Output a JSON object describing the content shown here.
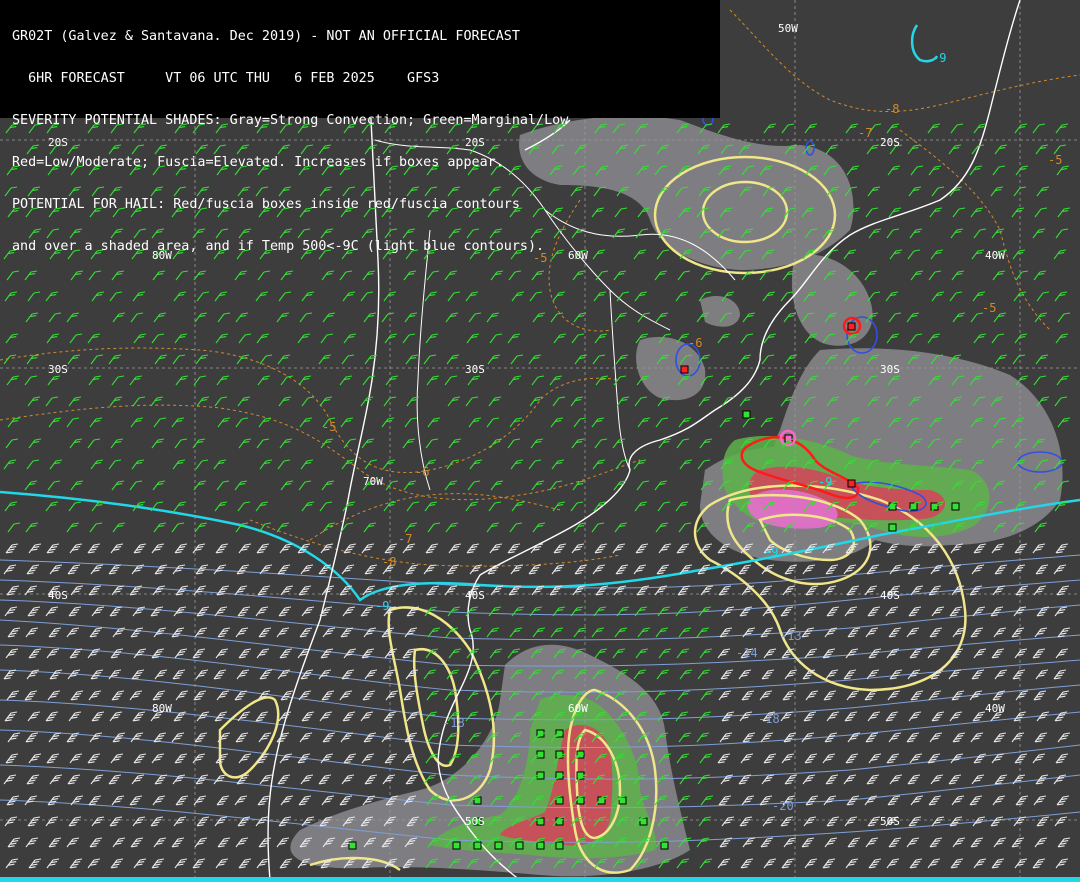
{
  "header": {
    "line1": "GR02T (Galvez & Santavana. Dec 2019) - NOT AN OFFICIAL FORECAST",
    "line2": "  6HR FORECAST     VT 06 UTC THU   6 FEB 2025    GFS3",
    "line3": "SEVERITY POTENTIAL SHADES: Gray=Strong Convection; Green=Marginal/Low",
    "line4": "Red=Low/Moderate; Fuscia=Elevated. Increases if boxes appear.",
    "line5": "POTENTIAL FOR HAIL: Red/fuscia boxes inside red/fuscia contours",
    "line6": "and over a shaded area, and if Temp 500<-9C (light blue contours)."
  },
  "grid_labels": {
    "lat20w": "20S",
    "lat20c": "20S",
    "lat20e": "20S",
    "lat30w": "30S",
    "lat30c": "30S",
    "lat30e": "30S",
    "lat40w": "40S",
    "lat40c": "40S",
    "lat40e": "40S",
    "lat50c": "50S",
    "lat50e": "50S",
    "lon80n": "80W",
    "lon80s": "80W",
    "lon70": "70W",
    "lon60n": "60W",
    "lon60s": "60W",
    "lon50": "50W",
    "lon40n": "40W",
    "lon40s": "40W"
  },
  "temperature_labels": {
    "t_5a": "-5",
    "t_5b": "-5",
    "t_5c": "-5",
    "t_5d": "-5",
    "t_6a": "-6",
    "t_6b": "-6",
    "t_7a": "-7",
    "t_7b": "-7",
    "t_8a": "-8",
    "t_8b": "-8",
    "t_9a": "-9",
    "t_9b": "-9",
    "t_9c": "-9",
    "t_9d": "-9",
    "t_13": "-13",
    "t_14": "-14",
    "t_18a": "-18",
    "t_18b": "-18",
    "t_20": "-20"
  },
  "colors": {
    "background": "#3d3d3d",
    "strong_convection_gray": "#8a8a8e",
    "marginal_green": "#5db34a",
    "low_moderate_red": "#d2475a",
    "elevated_fuscia": "#e070c8",
    "temp_500_cyan": "#22d8e8",
    "wind_green": "#33e033",
    "wind_white": "#e8e8e8",
    "yellow_contour": "#f0e68a",
    "orange_contour": "#d18a2a",
    "steel_isotherm": "#7f9fd8"
  }
}
